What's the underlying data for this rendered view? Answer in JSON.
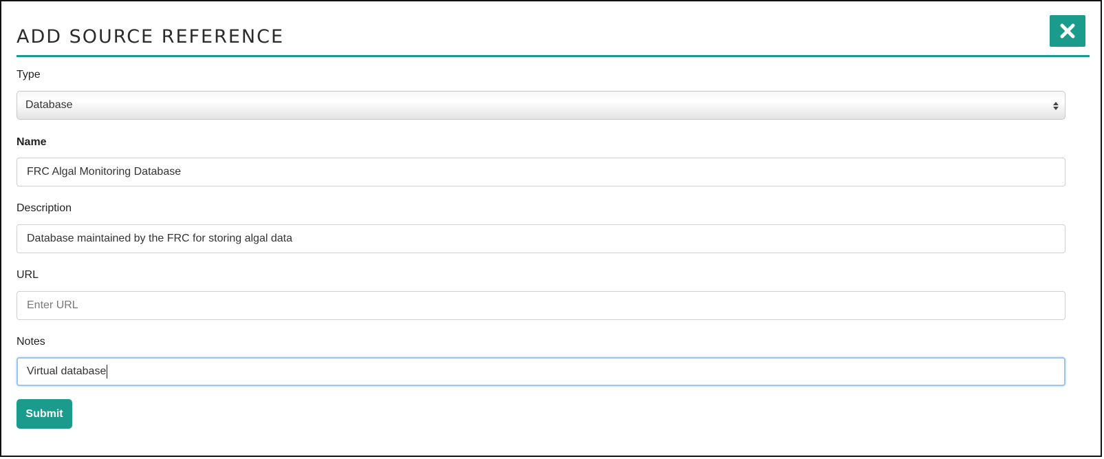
{
  "dialog": {
    "title": "ADD SOURCE REFERENCE",
    "close_icon": "close-x-icon",
    "accent_color": "#1a9b8c"
  },
  "form": {
    "type": {
      "label": "Type",
      "selected": "Database",
      "arrows_icon": "select-updown-arrows-icon"
    },
    "name": {
      "label": "Name",
      "value": "FRC Algal Monitoring Database"
    },
    "description": {
      "label": "Description",
      "value": "Database maintained by the FRC for storing algal data"
    },
    "url": {
      "label": "URL",
      "value": "",
      "placeholder": "Enter URL"
    },
    "notes": {
      "label": "Notes",
      "value": "Virtual database"
    },
    "submit_label": "Submit"
  }
}
